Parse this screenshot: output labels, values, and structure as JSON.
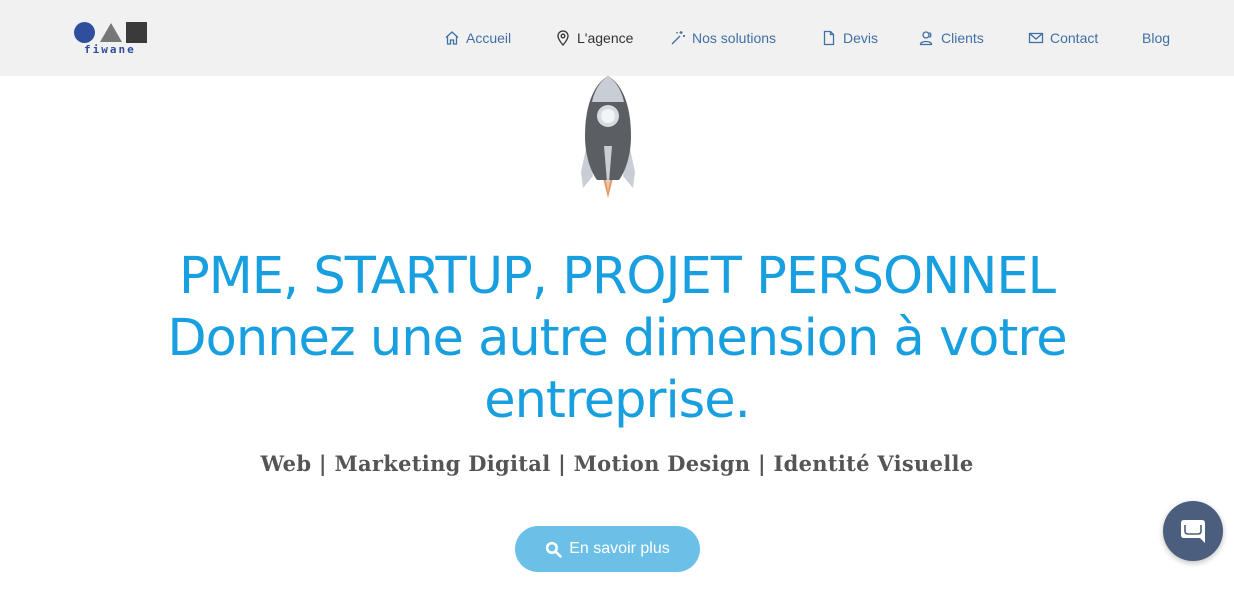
{
  "logo": {
    "text": "fiwane"
  },
  "nav": {
    "items": [
      {
        "label": "Accueil",
        "icon": "home-icon"
      },
      {
        "label": "L'agence",
        "icon": "map-pin-icon",
        "active": true
      },
      {
        "label": "Nos solutions",
        "icon": "magic-wand-icon"
      },
      {
        "label": "Devis",
        "icon": "document-icon"
      },
      {
        "label": "Clients",
        "icon": "users-icon"
      },
      {
        "label": "Contact",
        "icon": "envelope-icon"
      },
      {
        "label": "Blog",
        "icon": ""
      }
    ]
  },
  "hero": {
    "line1": "PME, STARTUP, PROJET PERSONNEL",
    "line2": "Donnez une autre dimension à votre entreprise.",
    "services": "Web | Marketing Digital | Motion Design | Identité Visuelle",
    "cta_label": "En savoir plus"
  },
  "colors": {
    "headline": "#189fe0",
    "nav_link": "#3f70a6",
    "cta_bg": "#6cc0e8",
    "chat_bg": "#4b5e7e"
  }
}
